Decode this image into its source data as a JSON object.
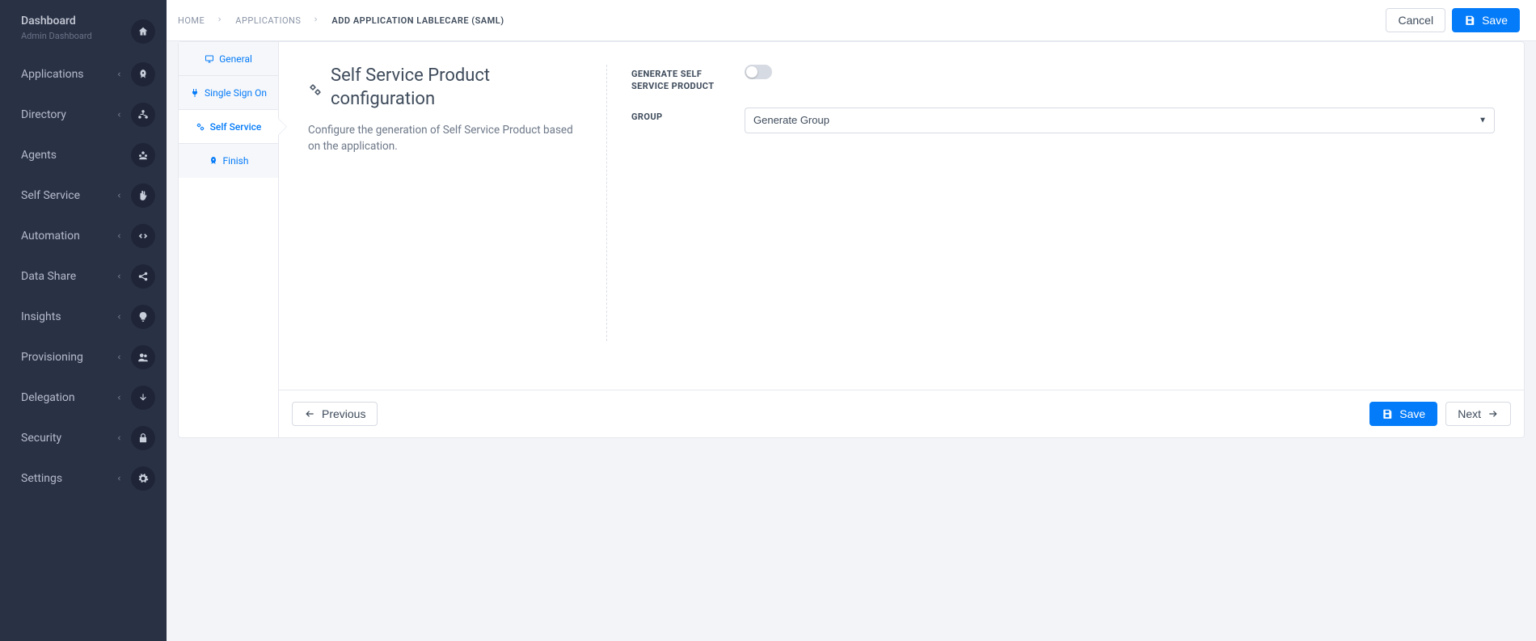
{
  "sidebar": {
    "heading": "Dashboard",
    "subheading": "Admin Dashboard",
    "items": [
      {
        "label": "Applications",
        "icon": "rocket",
        "expandable": true
      },
      {
        "label": "Directory",
        "icon": "hub",
        "expandable": true
      },
      {
        "label": "Agents",
        "icon": "agent",
        "expandable": false
      },
      {
        "label": "Self Service",
        "icon": "hand",
        "expandable": true
      },
      {
        "label": "Automation",
        "icon": "code",
        "expandable": true
      },
      {
        "label": "Data Share",
        "icon": "share",
        "expandable": true
      },
      {
        "label": "Insights",
        "icon": "bulb",
        "expandable": true
      },
      {
        "label": "Provisioning",
        "icon": "users",
        "expandable": true
      },
      {
        "label": "Delegation",
        "icon": "arrowdown",
        "expandable": true
      },
      {
        "label": "Security",
        "icon": "lock",
        "expandable": true
      },
      {
        "label": "Settings",
        "icon": "gear",
        "expandable": true
      }
    ]
  },
  "breadcrumb": [
    {
      "label": "HOME"
    },
    {
      "label": "APPLICATIONS"
    },
    {
      "label": "ADD APPLICATION LABLECARE (SAML)",
      "current": true
    }
  ],
  "top_actions": {
    "cancel": "Cancel",
    "save": "Save"
  },
  "steps": [
    {
      "label": "General",
      "icon": "monitor"
    },
    {
      "label": "Single Sign On",
      "icon": "plug"
    },
    {
      "label": "Self Service",
      "icon": "gears",
      "active": true
    },
    {
      "label": "Finish",
      "icon": "rocket"
    }
  ],
  "page": {
    "title": "Self Service Product configuration",
    "description": "Configure the generation of Self Service Product based on the application."
  },
  "form": {
    "generate_label": "GENERATE SELF SERVICE PRODUCT",
    "generate_value": false,
    "group_label": "GROUP",
    "group_value": "Generate Group",
    "group_options": [
      "Generate Group"
    ]
  },
  "footer": {
    "previous": "Previous",
    "save": "Save",
    "next": "Next"
  }
}
